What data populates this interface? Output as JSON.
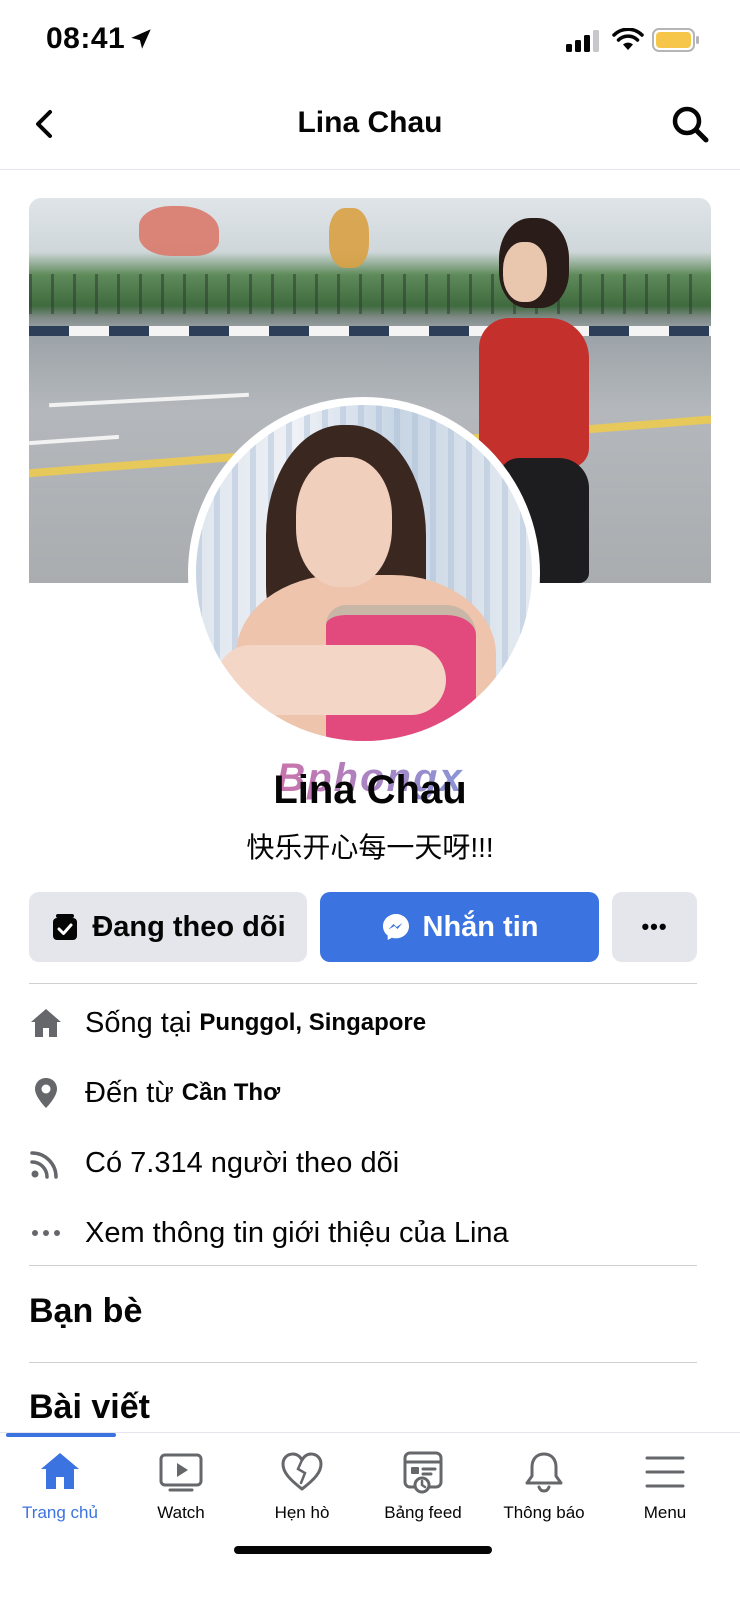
{
  "status_bar": {
    "time": "08:41",
    "icons": [
      "location-arrow-icon",
      "signal-icon",
      "wifi-icon",
      "battery-icon"
    ],
    "battery_color": "#f5c64a"
  },
  "nav": {
    "title": "Lina Chau",
    "back_icon": "chevron-left-icon",
    "search_icon": "search-icon"
  },
  "profile": {
    "watermark": "Bphongx",
    "name": "Lina Chau",
    "bio": "快乐开心每一天呀!!!"
  },
  "actions": {
    "following_label": "Đang theo dõi",
    "message_label": "Nhắn tin",
    "more_label": "•••",
    "message_color": "#3b73e0"
  },
  "info": {
    "lives_prefix": "Sống tại ",
    "lives_value": "Punggol, Singapore",
    "from_prefix": "Đến từ ",
    "from_value": "Cần Thơ",
    "followers": "Có 7.314 người theo dõi",
    "about": "Xem thông tin giới thiệu của Lina"
  },
  "sections": {
    "friends": "Bạn bè",
    "posts": "Bài viết"
  },
  "tabbar": {
    "items": [
      {
        "label": "Trang chủ",
        "icon": "home-icon",
        "active": true
      },
      {
        "label": "Watch",
        "icon": "watch-icon",
        "active": false
      },
      {
        "label": "Hẹn hò",
        "icon": "heart-icon",
        "active": false
      },
      {
        "label": "Bảng feed",
        "icon": "feed-icon",
        "active": false
      },
      {
        "label": "Thông báo",
        "icon": "bell-icon",
        "active": false
      },
      {
        "label": "Menu",
        "icon": "menu-icon",
        "active": false
      }
    ],
    "active_color": "#3b73e0"
  }
}
